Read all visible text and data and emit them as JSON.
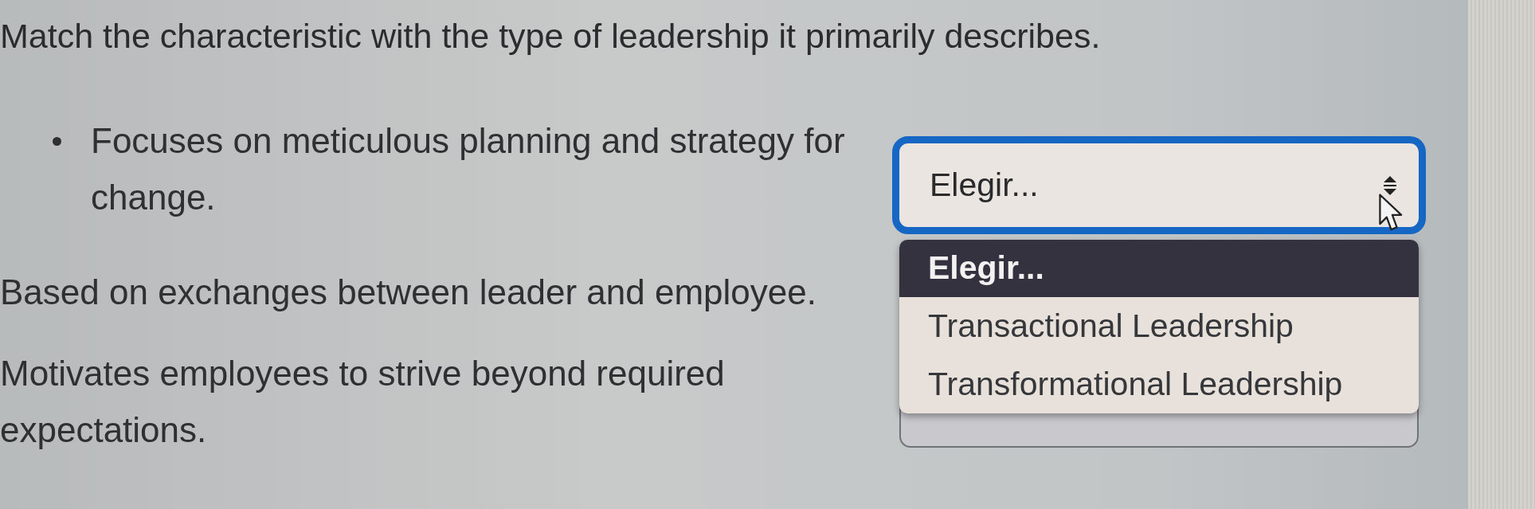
{
  "instruction": "Match the characteristic with the type of leadership it primarily describes.",
  "items": [
    {
      "text": "Focuses on meticulous planning and strategy for change.",
      "bulleted": true,
      "select": {
        "value": "Elegir...",
        "focused": true,
        "expanded": true,
        "options": [
          {
            "label": "Elegir...",
            "selected": true
          },
          {
            "label": "Transactional Leadership",
            "selected": false
          },
          {
            "label": "Transformational Leadership",
            "selected": false
          }
        ]
      }
    },
    {
      "text": "Based on exchanges between leader and employee.",
      "bulleted": false
    },
    {
      "text": "Motivates employees to strive beyond required expectations.",
      "bulleted": false,
      "select": {
        "focused": false,
        "expanded": false
      }
    }
  ]
}
